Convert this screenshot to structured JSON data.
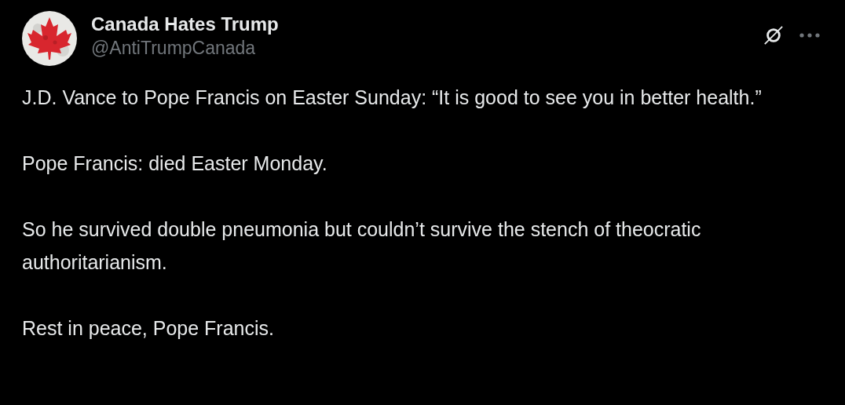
{
  "author": {
    "name": "Canada Hates Trump",
    "handle": "@AntiTrumpCanada"
  },
  "paragraphs": [
    "J.D. Vance to Pope Francis on Easter Sunday: “It is good to see you in better health.”",
    "Pope Francis: died Easter Monday.",
    "So he survived double pneumonia but couldn’t survive the stench of theocratic authoritarianism.",
    "Rest in peace, Pope Francis."
  ]
}
